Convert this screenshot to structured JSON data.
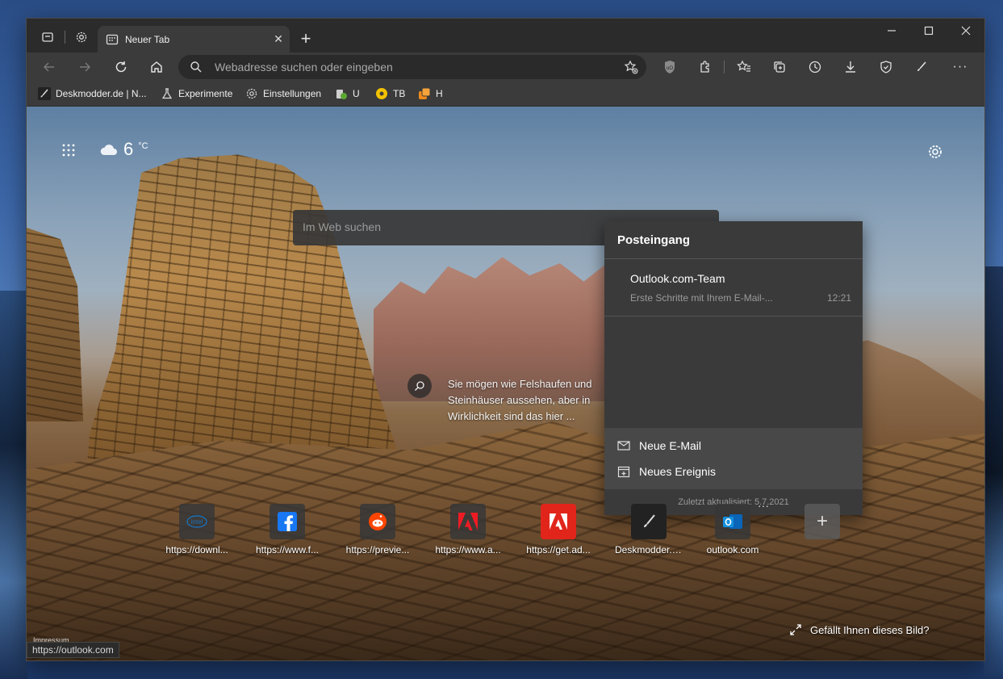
{
  "browser": {
    "tab_title": "Neuer Tab",
    "address_placeholder": "Webadresse suchen oder eingeben"
  },
  "favorites": [
    {
      "label": "Deskmodder.de | N...",
      "icon": "brush-icon"
    },
    {
      "label": "Experimente",
      "icon": "flask-icon"
    },
    {
      "label": "Einstellungen",
      "icon": "gear-icon"
    },
    {
      "label": "U",
      "icon": "extension-icon"
    },
    {
      "label": "TB",
      "icon": "coin-icon"
    },
    {
      "label": "H",
      "icon": "orange-icon"
    }
  ],
  "newtab": {
    "temperature": "6",
    "unit": "°C",
    "search_placeholder": "Im Web suchen",
    "image_info": "Sie mögen wie Felshaufen und Steinhäuser aussehen, aber in Wirklichkeit sind das hier ...",
    "like_image": "Gefällt Ihnen dieses Bild?",
    "impressum": "Impressum"
  },
  "inbox": {
    "title": "Posteingang",
    "mail_from": "Outlook.com-Team",
    "mail_subject": "Erste Schritte mit Ihrem E-Mail-...",
    "mail_time": "12:21",
    "new_mail": "Neue E-Mail",
    "new_event": "Neues Ereignis",
    "updated": "Zuletzt aktualisiert: 5.7.2021"
  },
  "top_sites": [
    {
      "label": "https://downl...",
      "icon": "intel-icon"
    },
    {
      "label": "https://www.f...",
      "icon": "facebook-icon"
    },
    {
      "label": "https://previe...",
      "icon": "reddit-icon"
    },
    {
      "label": "https://www.a...",
      "icon": "adobe-icon"
    },
    {
      "label": "https://get.ad...",
      "icon": "adobe-icon"
    },
    {
      "label": "Deskmodder.de",
      "icon": "brush-icon"
    },
    {
      "label": "outlook.com",
      "icon": "outlook-icon"
    }
  ],
  "status_url": "https://outlook.com"
}
